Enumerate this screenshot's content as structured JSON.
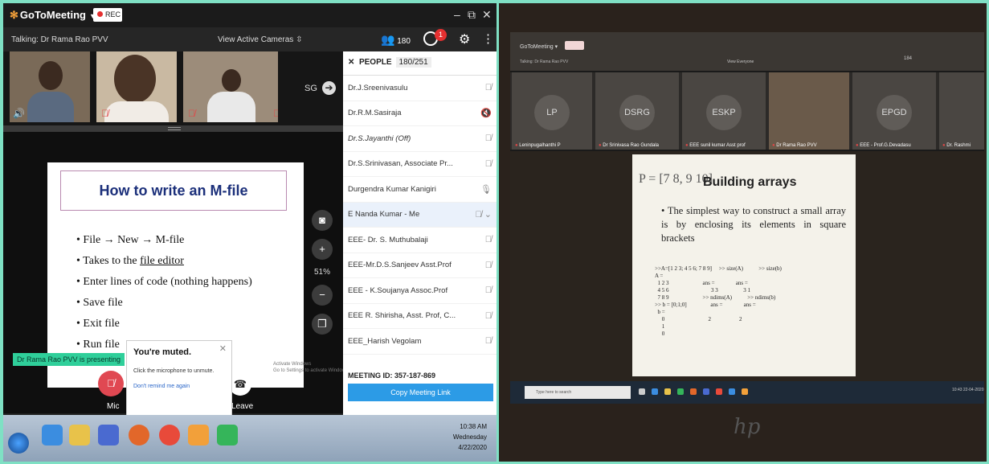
{
  "left": {
    "app_name": "GoToMeeting",
    "rec_label": "REC",
    "window_controls": [
      "–",
      "⧉",
      "✕"
    ],
    "talking": "Talking: Dr Rama Rao PVV",
    "view_cameras": "View Active Cameras",
    "people_count": "180",
    "chat_badge": "1",
    "video_tile_initials": "SG",
    "slide": {
      "title": "How to write an M-file",
      "bullets": [
        "File → New → M-file",
        "Takes to the",
        "Enter lines of code (nothing happens)",
        "Save file",
        "Exit file",
        "Run file"
      ],
      "bullet2_link": "file editor"
    },
    "zoom": "51%",
    "presenting": "Dr Rama Rao PVV is presenting",
    "activate": "Activate Windows",
    "activate_sub": "Go to Settings to activate Windows",
    "muted": {
      "title": "You're muted.",
      "desc": "Click the microphone to unmute.",
      "link": "Don't remind me again"
    },
    "mic_label": "Mic",
    "leave_label": "Leave",
    "people_panel": {
      "title": "PEOPLE",
      "count": "180/251",
      "rows": [
        {
          "name": "Dr.J.Sreenivasulu",
          "icon": "🎙̸"
        },
        {
          "name": "Dr.R.M.Sasiraja",
          "icon": "🔇"
        },
        {
          "name": "Dr.S.Jayanthi  (Off)",
          "icon": "🎙̸"
        },
        {
          "name": "Dr.S.Srinivasan, Associate Pr...",
          "icon": "🎙̸"
        },
        {
          "name": "Durgendra Kumar Kanigiri",
          "icon": "🎙"
        },
        {
          "name": "E Nanda Kumar  - Me",
          "icon": "🎙̸ ⌄"
        },
        {
          "name": "EEE- Dr. S. Muthubalaji",
          "icon": "🎙̸"
        },
        {
          "name": "EEE-Mr.D.S.Sanjeev Asst.Prof",
          "icon": "🎙̸"
        },
        {
          "name": "EEE - K.Soujanya Assoc.Prof",
          "icon": "🎙̸"
        },
        {
          "name": "EEE R. Shirisha, Asst. Prof, C...",
          "icon": "🎙̸"
        },
        {
          "name": "EEE_Harish Vegolam",
          "icon": "🎙̸"
        }
      ],
      "meeting_id": "MEETING ID:  357-187-869",
      "copy_btn": "Copy Meeting Link"
    },
    "clock": {
      "time": "10:38 AM",
      "day": "Wednesday",
      "date": "4/22/2020"
    }
  },
  "right": {
    "app_name": "GoToMeeting ▾",
    "talking": "Talking: Dr Rama Rao PVV",
    "view_everyone": "View Everyone",
    "people_count": "184",
    "tiles": [
      {
        "initials": "LP",
        "name": "Leninpugalhanthi P"
      },
      {
        "initials": "DSRG",
        "name": "Dr Srinivasa Rao Gundala"
      },
      {
        "initials": "ESKP",
        "name": "EEE sunil kumar Asst prof"
      },
      {
        "initials": "",
        "name": "Dr Rama Rao PVV"
      },
      {
        "initials": "EPGD",
        "name": "EEE - Prof.G.Devadasu"
      },
      {
        "initials": "",
        "name": "Dr. Rashmi"
      }
    ],
    "slide": {
      "handwriting": "P = [7 8, 9 10]",
      "title": "Building arrays",
      "text": "• The simplest way to construct a small array is by enclosing its elements in square brackets",
      "code": ">>A=[1 2 3; 4 5 6; 7 8 9]     >> size(A)           >> size(b)\nA =\n  1 2 3                        ans =               ans =\n  4 5 6                              3 3                  3 1\n  7 8 9                        >> ndims(A)           >> ndims(b)\n>> b = [0;1;0]                 ans =               ans =\n  b =\n     0                               2                    2\n     1\n     0"
    },
    "search_placeholder": "Type here to search",
    "clock": "10:43\n22-04-2020",
    "brand": "hp"
  }
}
